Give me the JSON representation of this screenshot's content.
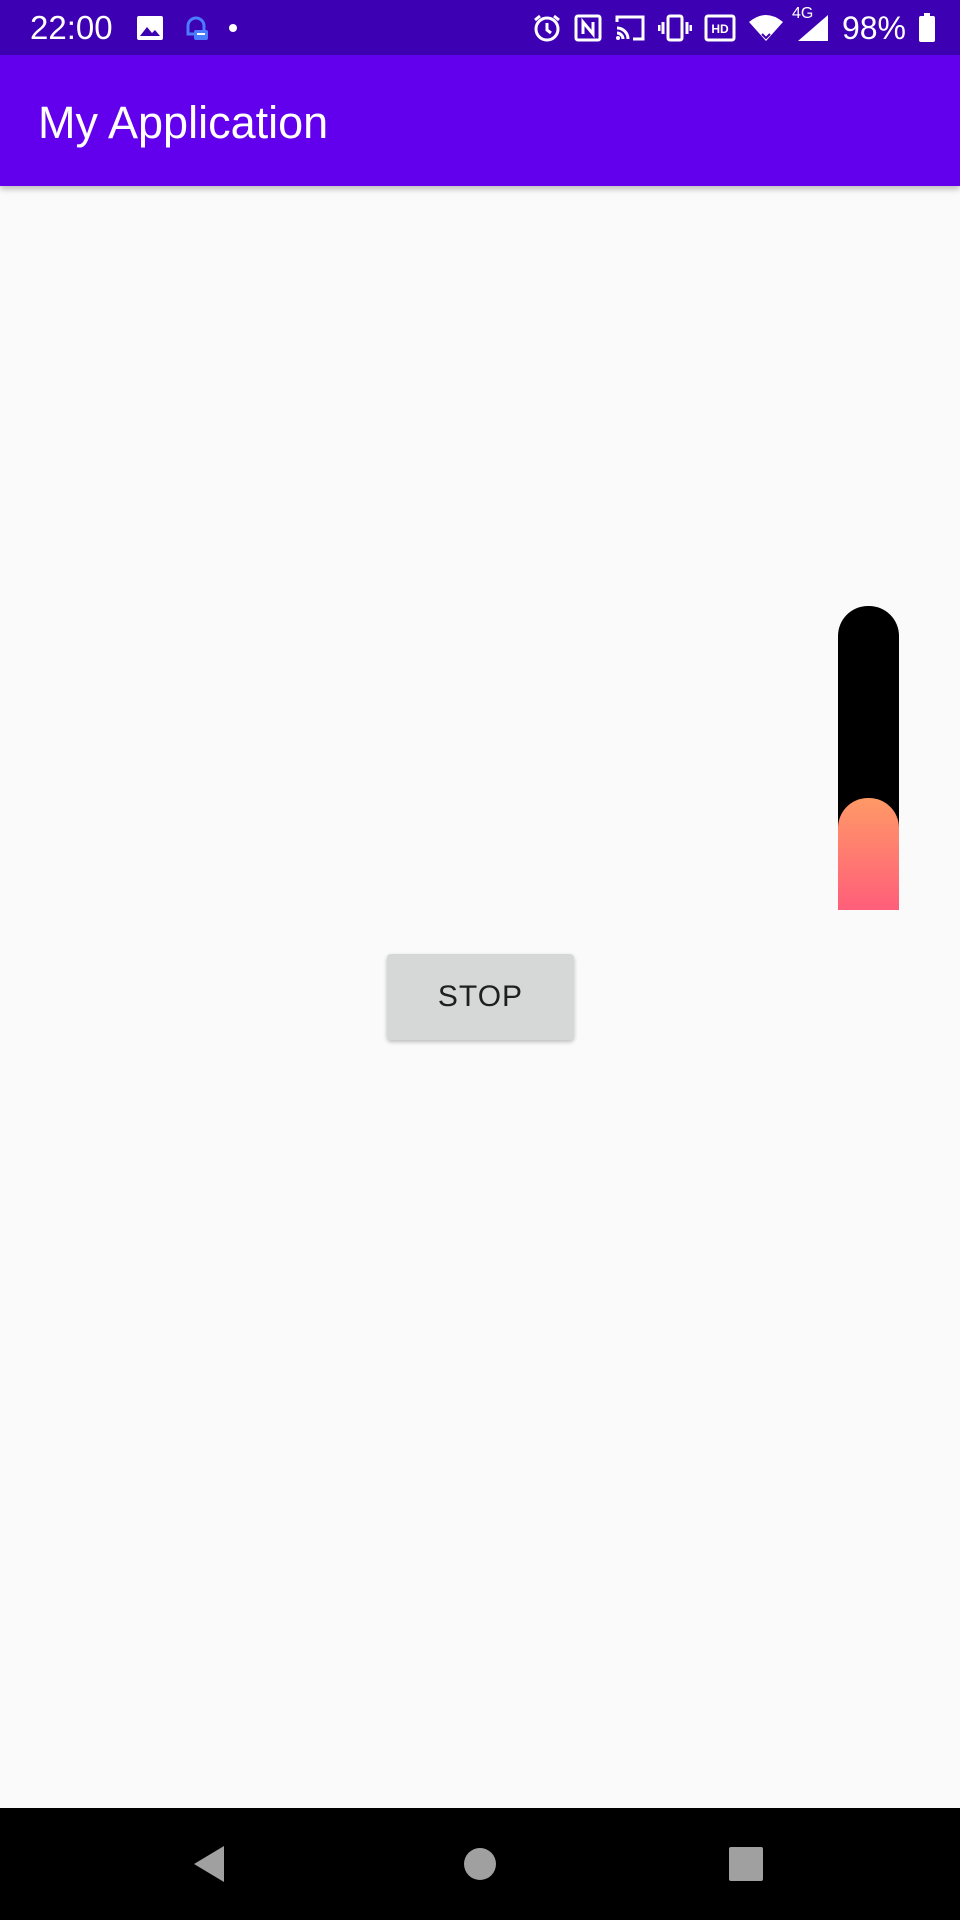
{
  "status_bar": {
    "time": "22:00",
    "network_label": "4G",
    "battery": "98%",
    "left_icons": [
      "image-icon",
      "chat-notification-icon",
      "dot-icon"
    ],
    "right_icons": [
      "alarm-icon",
      "nfc-icon",
      "cast-icon",
      "vibrate-icon",
      "hd-icon",
      "wifi-icon",
      "signal-icon",
      "battery-icon"
    ],
    "background_color": "#3d00b3"
  },
  "app_bar": {
    "title": "My Application",
    "background_color": "#6200ee"
  },
  "progress": {
    "orientation": "vertical",
    "value_fraction": 0.37,
    "track_color": "#000000",
    "fill_gradient": [
      "#ff9966",
      "#ff5e7a"
    ]
  },
  "stop_button": {
    "label": "STOP"
  },
  "navigation": {
    "buttons": [
      "back-icon",
      "home-icon",
      "recents-icon"
    ]
  }
}
